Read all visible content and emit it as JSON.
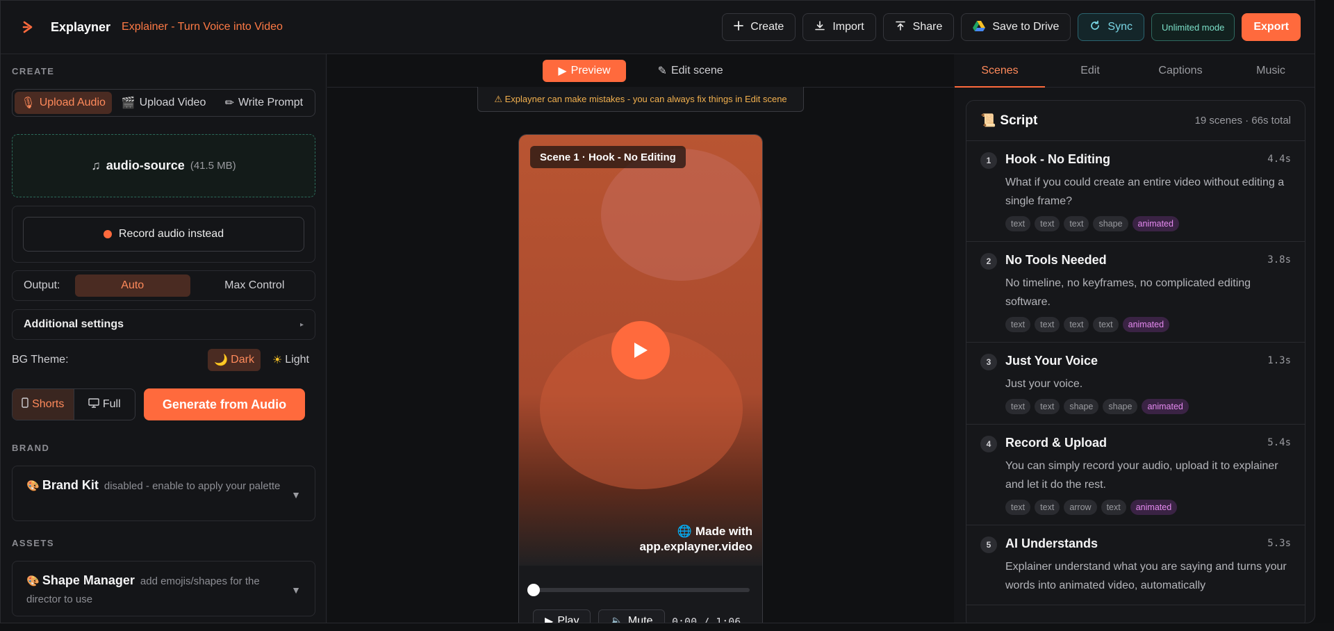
{
  "header": {
    "brand": "Explayner",
    "tagline": "Explainer - Turn Voice into Video",
    "buttons": {
      "create": "Create",
      "import": "Import",
      "share": "Share",
      "save_drive": "Save to Drive",
      "sync": "Sync",
      "unlimited": "Unlimited mode",
      "export": "Export"
    }
  },
  "left": {
    "create_label": "CREATE",
    "source_tabs": [
      "Upload Audio",
      "Upload Video",
      "Write Prompt"
    ],
    "source_icons": [
      "🎙",
      "🎬",
      "✏"
    ],
    "file": {
      "icon": "♫",
      "name": "audio-source",
      "size": "(41.5 MB)"
    },
    "record_label": "Record audio instead",
    "output": {
      "label": "Output:",
      "options": [
        "Auto",
        "Max Control"
      ]
    },
    "additional_settings": "Additional settings",
    "bg_theme": {
      "label": "BG Theme:",
      "dark": "Dark",
      "light": "Light",
      "dark_icon": "🌙",
      "light_icon": "☀"
    },
    "format": {
      "shorts": "Shorts",
      "full": "Full"
    },
    "generate": "Generate from Audio",
    "brand_label": "BRAND",
    "brand_kit": {
      "title": "Brand Kit",
      "desc": "disabled - enable to apply your palette"
    },
    "assets_label": "ASSETS",
    "shape_manager": {
      "title": "Shape Manager",
      "desc": "add emojis/shapes for the director to use"
    }
  },
  "center": {
    "tabs": {
      "preview": "Preview",
      "edit": "Edit scene"
    },
    "warning": "⚠ Explayner can make mistakes - you can always fix things in Edit scene",
    "scene_label": "Scene 1 · Hook - No Editing",
    "watermark_line1": "Made with",
    "watermark_line2": "app.explayner.video",
    "play": "Play",
    "mute": "Mute",
    "time": "0:00 / 1:06",
    "progress": 0
  },
  "right": {
    "tabs": [
      "Scenes",
      "Edit",
      "Captions",
      "Music"
    ],
    "script_title": "Script",
    "script_meta": "19 scenes · 66s total",
    "scenes": [
      {
        "num": "1",
        "name": "Hook - No Editing",
        "dur": "4.4s",
        "text": "What if you could create an entire video without editing a single frame?",
        "tags": [
          "text",
          "text",
          "text",
          "shape",
          "animated"
        ]
      },
      {
        "num": "2",
        "name": "No Tools Needed",
        "dur": "3.8s",
        "text": "No timeline, no keyframes, no complicated editing software.",
        "tags": [
          "text",
          "text",
          "text",
          "text",
          "animated"
        ]
      },
      {
        "num": "3",
        "name": "Just Your Voice",
        "dur": "1.3s",
        "text": "Just your voice.",
        "tags": [
          "text",
          "text",
          "shape",
          "shape",
          "animated"
        ]
      },
      {
        "num": "4",
        "name": "Record & Upload",
        "dur": "5.4s",
        "text": "You can simply record your audio, upload it to explainer and let it do the rest.",
        "tags": [
          "text",
          "text",
          "arrow",
          "text",
          "animated"
        ]
      },
      {
        "num": "5",
        "name": "AI Understands",
        "dur": "5.3s",
        "text": "Explainer understand what you are saying and turns your words into animated video, automatically",
        "tags": []
      }
    ]
  },
  "colors": {
    "accent": "#ff6a3d",
    "bg": "#141518",
    "animated_tag": "#e58af0"
  }
}
